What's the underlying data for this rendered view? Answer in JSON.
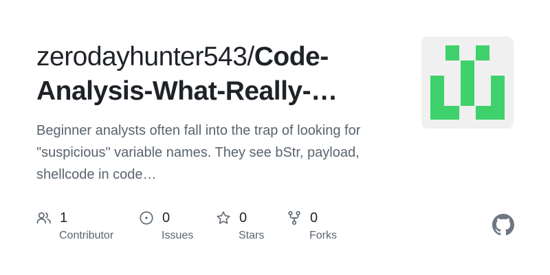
{
  "owner": "zerodayhunter543/",
  "repo": "Code-Analysis-What-Really-…",
  "repo_line1": "Code-",
  "repo_line2": "Analysis-What-Really-…",
  "description": "Beginner analysts often fall into the trap of looking for \"suspicious\" variable names. They see bStr, payload, shellcode in code…",
  "avatar_color": "#3fd16b",
  "stats": [
    {
      "icon": "people-icon",
      "count": "1",
      "label": "Contributor"
    },
    {
      "icon": "issue-icon",
      "count": "0",
      "label": "Issues"
    },
    {
      "icon": "star-icon",
      "count": "0",
      "label": "Stars"
    },
    {
      "icon": "fork-icon",
      "count": "0",
      "label": "Forks"
    }
  ],
  "logo": "github-logo-icon"
}
